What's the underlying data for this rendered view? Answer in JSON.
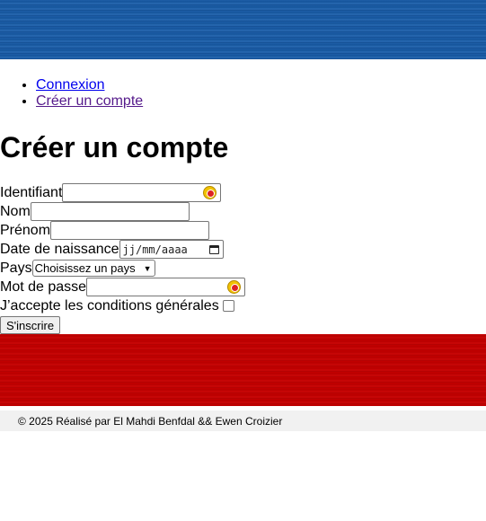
{
  "nav": {
    "links": [
      {
        "label": "Connexion"
      },
      {
        "label": "Créer un compte"
      }
    ]
  },
  "page": {
    "title": "Créer un compte"
  },
  "form": {
    "identifiant_label": "Identifiant",
    "nom_label": "Nom",
    "prenom_label": "Prénom",
    "date_label": "Date de naissance",
    "date_placeholder": "jj/mm/aaaa",
    "pays_label": "Pays",
    "pays_selected": "Choisissez un pays",
    "password_label": "Mot de passe",
    "terms_label": "J’accepte les conditions générales",
    "submit_label": "S'inscrire"
  },
  "footer": {
    "text": "© 2025 Réalisé par El Mahdi Benfdal && Ewen Croizier"
  },
  "colors": {
    "top_banner": "#1e5fa8",
    "bottom_banner": "#c40000",
    "footer_bg": "#f1f1f1"
  }
}
